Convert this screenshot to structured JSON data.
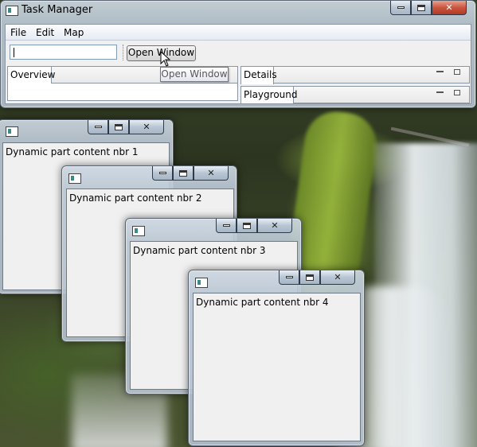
{
  "main_window": {
    "title": "Task Manager",
    "menu": [
      "File",
      "Edit",
      "Map"
    ],
    "search_value": "",
    "open_button_label": "Open Window",
    "tooltip": "Open Window",
    "left_tab": "Overview",
    "right_tabs": [
      "Details",
      "Playground"
    ]
  },
  "dynamic_windows": [
    {
      "content": "Dynamic part content nbr 1"
    },
    {
      "content": "Dynamic part content nbr 2"
    },
    {
      "content": "Dynamic part content nbr 3"
    },
    {
      "content": "Dynamic part content nbr 4"
    }
  ],
  "icons": {
    "minimize": "minimize-icon",
    "maximize": "maximize-icon",
    "close": "close-icon",
    "app": "app-icon",
    "cursor": "mouse-pointer-icon"
  },
  "colors": {
    "close_button": "#c9553f",
    "frame": "#b8c6d4",
    "client": "#f0f0f0"
  }
}
